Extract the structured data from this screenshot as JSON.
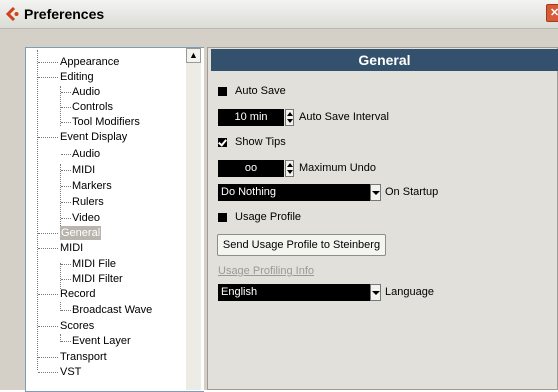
{
  "window": {
    "title": "Preferences",
    "close_glyph": "✕"
  },
  "tree": {
    "scroll_up_glyph": "▲",
    "items": [
      {
        "label": "Appearance"
      },
      {
        "label": "Editing"
      },
      {
        "label": "Audio"
      },
      {
        "label": "Controls"
      },
      {
        "label": "Tool Modifiers"
      },
      {
        "label": "Event Display"
      },
      {
        "label": "Audio"
      },
      {
        "label": "MIDI"
      },
      {
        "label": "Markers"
      },
      {
        "label": "Rulers"
      },
      {
        "label": "Video"
      },
      {
        "label": "General",
        "selected": true
      },
      {
        "label": "MIDI"
      },
      {
        "label": "MIDI File"
      },
      {
        "label": "MIDI Filter"
      },
      {
        "label": "Record"
      },
      {
        "label": "Broadcast Wave"
      },
      {
        "label": "Scores"
      },
      {
        "label": "Event Layer"
      },
      {
        "label": "Transport"
      },
      {
        "label": "VST"
      }
    ]
  },
  "general": {
    "header": "General",
    "auto_save": {
      "label": "Auto Save",
      "checked": false
    },
    "auto_save_interval": {
      "value": "10 min",
      "label": "Auto Save Interval"
    },
    "show_tips": {
      "label": "Show Tips",
      "checked": true
    },
    "maximum_undo": {
      "value": "oo",
      "label": "Maximum Undo"
    },
    "on_startup": {
      "value": "Do Nothing",
      "label": "On Startup"
    },
    "usage_profile": {
      "label": "Usage Profile",
      "checked": false
    },
    "send_button": "Send Usage Profile to Steinberg",
    "usage_info_link": "Usage Profiling Info",
    "language": {
      "value": "English",
      "label": "Language"
    }
  },
  "colors": {
    "header_bar": "#33506c",
    "panel_bg": "#e2e0da",
    "selected_item": "#b7b5ad",
    "title_icon": "#d0401a"
  }
}
